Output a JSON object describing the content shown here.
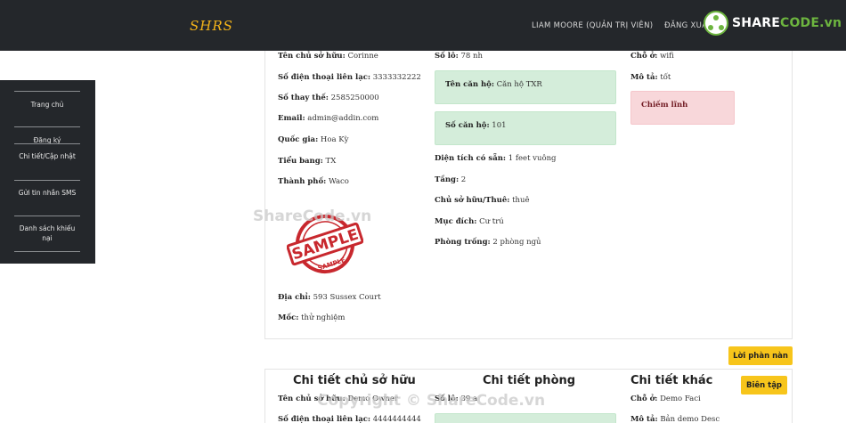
{
  "navbar": {
    "brand": "SHRS",
    "user": "LIAM MOORE (QUẢN TRỊ VIÊN)",
    "logout": "ĐĂNG XUẤT"
  },
  "watermark": {
    "logo_prefix": "SHARE",
    "logo_suffix": "CODE.vn",
    "center": "ShareCode.vn",
    "bottom": "Copyright © ShareCode.vn"
  },
  "sidebar": {
    "items": [
      {
        "label": "Trang chủ"
      },
      {
        "label": "Đăng ký"
      },
      {
        "label": "Chi tiết/Cập nhật"
      },
      {
        "label": "Gửi tin nhắn SMS"
      },
      {
        "label": "Danh sách khiếu nại"
      }
    ]
  },
  "record1": {
    "owner": [
      {
        "label": "Tên chủ sở hữu:",
        "value": "Corinne"
      },
      {
        "label": "Số điện thoại liên lạc:",
        "value": "3333332222"
      },
      {
        "label": "Số thay thế:",
        "value": "2585250000"
      },
      {
        "label": "Email:",
        "value": "admin@addin.com"
      },
      {
        "label": "Quốc gia:",
        "value": "Hoa Kỳ"
      },
      {
        "label": "Tiểu bang:",
        "value": "TX"
      },
      {
        "label": "Thành phố:",
        "value": "Waco"
      },
      {
        "label": "Địa chỉ:",
        "value": "593 Sussex Court"
      },
      {
        "label": "Mốc:",
        "value": "thử nghiệm"
      }
    ],
    "room": {
      "plot": {
        "label": "Số lô:",
        "value": "78 nh"
      },
      "apartment_name": {
        "label": "Tên căn hộ:",
        "value": "Căn hộ TXR"
      },
      "apartment_no": {
        "label": "Số căn hộ:",
        "value": "101"
      },
      "fields": [
        {
          "label": "Diện tích có sẵn:",
          "value": "1 feet vuông"
        },
        {
          "label": "Tầng:",
          "value": "2"
        },
        {
          "label": "Chủ sở hữu/Thuê:",
          "value": "thuê"
        },
        {
          "label": "Mục đích:",
          "value": "Cư trú"
        },
        {
          "label": "Phòng trống:",
          "value": "2 phòng ngủ"
        }
      ]
    },
    "other": [
      {
        "label": "Chỗ ở:",
        "value": "wifi"
      },
      {
        "label": "Mô tả:",
        "value": "tốt"
      }
    ],
    "status": "Chiếm lĩnh",
    "stamp_text": "SAMPLE",
    "stamp_ring": "SAMPLE"
  },
  "complaint_button": "Lời phàn nàn",
  "record2": {
    "titles": {
      "owner": "Chi tiết chủ sở hữu",
      "room": "Chi tiết phòng",
      "other": "Chi tiết khác"
    },
    "edit_button": "Biên tập",
    "owner": [
      {
        "label": "Tên chủ sở hữu:",
        "value": "Demo Owner"
      },
      {
        "label": "Số điện thoại liên lạc:",
        "value": "4444444444"
      }
    ],
    "room": [
      {
        "label": "Số lô:",
        "value": "39 a"
      }
    ],
    "other": [
      {
        "label": "Chỗ ở:",
        "value": "Demo Faci"
      },
      {
        "label": "Mô tả:",
        "value": "Bản demo Desc"
      }
    ]
  },
  "colors": {
    "navbar_bg": "#24272b",
    "brand": "#f4b41a",
    "button_yellow": "#f7c51b",
    "success_bg": "#d4edda",
    "danger_bg": "#f8d7da",
    "stamp_red": "#c8282e"
  }
}
